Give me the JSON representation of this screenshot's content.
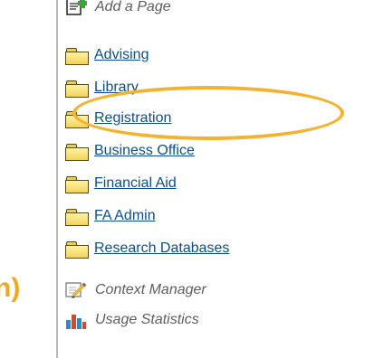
{
  "left_fragment": {
    "cutoff_text": "n)"
  },
  "sidebar": {
    "add_page_label": "Add a Page",
    "folders": [
      {
        "label": "Advising"
      },
      {
        "label": "Library"
      },
      {
        "label": "Registration"
      },
      {
        "label": "Business Office"
      },
      {
        "label": "Financial Aid"
      },
      {
        "label": "FA Admin"
      },
      {
        "label": "Research Databases"
      }
    ],
    "tools": [
      {
        "label": "Context Manager",
        "icon": "context-manager-icon"
      },
      {
        "label": "Usage Statistics",
        "icon": "bar-chart-icon"
      }
    ],
    "highlighted_item": "Registration"
  },
  "colors": {
    "link": "#0b4f8c",
    "folder_fill": "#f2d35c",
    "highlight": "#f2b330",
    "tool_text": "#5e5e5e"
  }
}
